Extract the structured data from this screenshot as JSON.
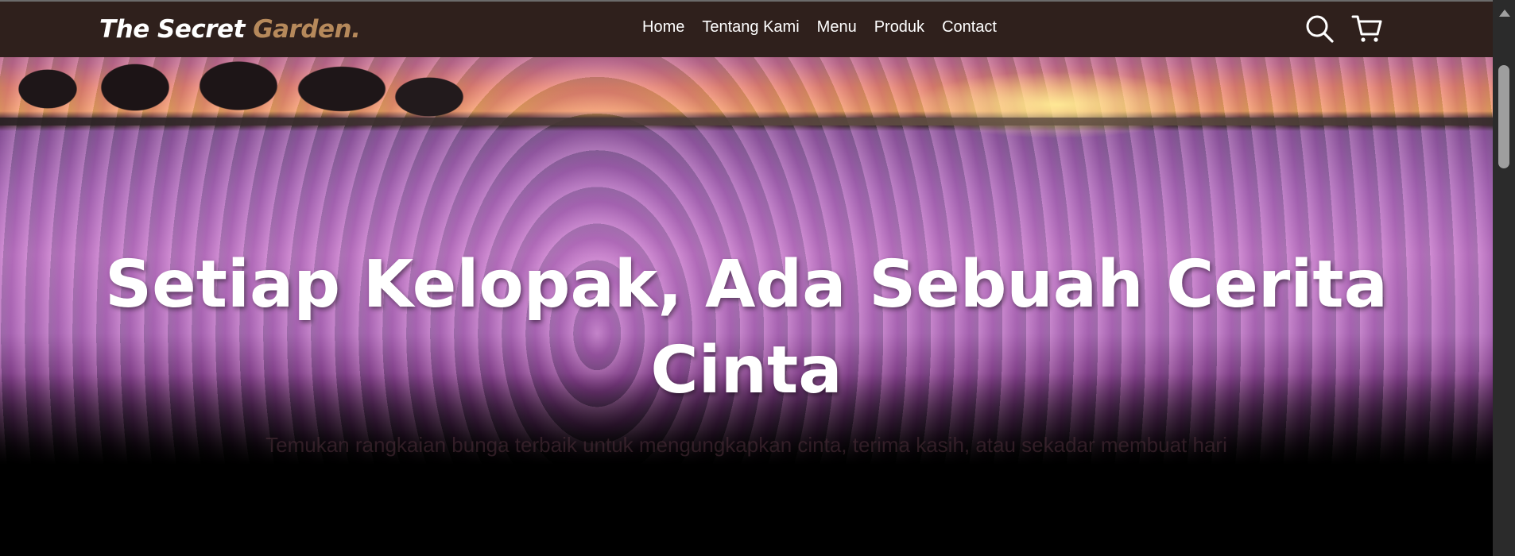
{
  "header": {
    "logo_main": "The Secret ",
    "logo_accent": "Garden.",
    "nav": [
      {
        "label": "Home"
      },
      {
        "label": "Tentang Kami"
      },
      {
        "label": "Menu"
      },
      {
        "label": "Produk"
      },
      {
        "label": "Contact"
      }
    ],
    "icons": [
      "search-icon",
      "cart-icon"
    ]
  },
  "hero": {
    "title": "Setiap Kelopak, Ada Sebuah Cerita Cinta",
    "subtitle": "Temukan rangkaian bunga terbaik untuk mengungkapkan cinta, terima kasih, atau sekadar membuat hari"
  },
  "colors": {
    "navbar_bg": "#2f201c",
    "logo_accent": "#b6895b",
    "text_white": "#ffffff"
  }
}
